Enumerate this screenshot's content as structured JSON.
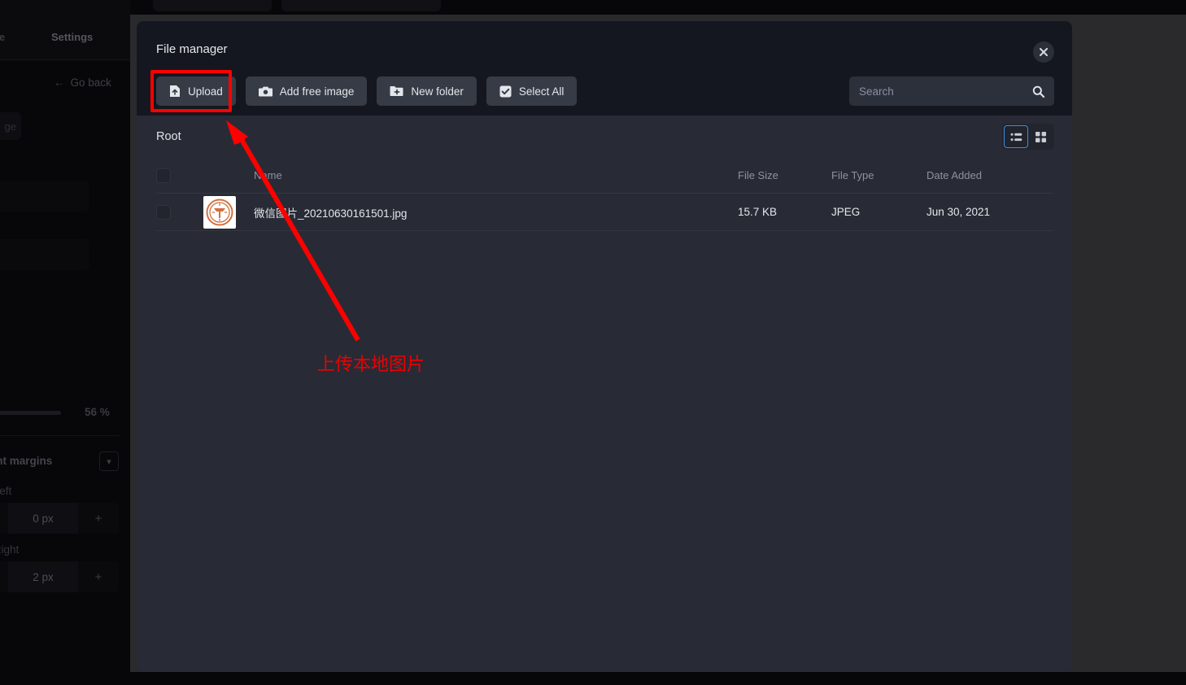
{
  "background_app": {
    "tabs": [
      {
        "label": "re",
        "name": "tab-store-partial"
      },
      {
        "label": "Settings",
        "name": "tab-settings"
      }
    ],
    "go_back_label": "Go back",
    "go_back_icon": "arrow-left-icon",
    "chip_button_label": "ge",
    "progress_value": "56 %",
    "select_label": "ependent margins",
    "select_caret_icon": "chevron-down-icon",
    "margin_left_label": "argin Left",
    "margin_left_value": "0 px",
    "margin_right_label": "argin Right",
    "margin_right_value": "2 px",
    "stepper_minus": "−",
    "stepper_plus": "+"
  },
  "modal": {
    "title": "File manager",
    "close_icon": "close-icon",
    "toolbar": [
      {
        "label": "Upload",
        "icon": "file-upload-icon",
        "name": "upload-button"
      },
      {
        "label": "Add free image",
        "icon": "camera-icon",
        "name": "add-free-image-button"
      },
      {
        "label": "New folder",
        "icon": "folder-plus-icon",
        "name": "new-folder-button"
      },
      {
        "label": "Select All",
        "icon": "checkbox-checked-icon",
        "name": "select-all-button"
      }
    ],
    "search": {
      "placeholder": "Search",
      "value": "",
      "icon": "search-icon"
    },
    "path": "Root",
    "view_toggle": {
      "list_icon": "list-view-icon",
      "grid_icon": "grid-view-icon",
      "active": "list"
    },
    "table": {
      "columns": [
        "Name",
        "File Size",
        "File Type",
        "Date Added"
      ],
      "rows": [
        {
          "name": "微信图片_20210630161501.jpg",
          "file_size": "15.7 KB",
          "file_type": "JPEG",
          "date_added": "Jun 30, 2021",
          "thumbnail_icon": "image-thumbnail-emblem"
        }
      ]
    }
  },
  "annotations": {
    "callout_text": "上传本地图片",
    "arrow_color": "#ff0000",
    "highlight_color": "#ff0000",
    "target": "upload-button"
  },
  "colors": {
    "modal_bg": "#282b35",
    "header_bg": "#14171f",
    "button_bg": "#373b46",
    "accent_blue": "#3f8ae0",
    "annotation_red": "#ff0000"
  }
}
